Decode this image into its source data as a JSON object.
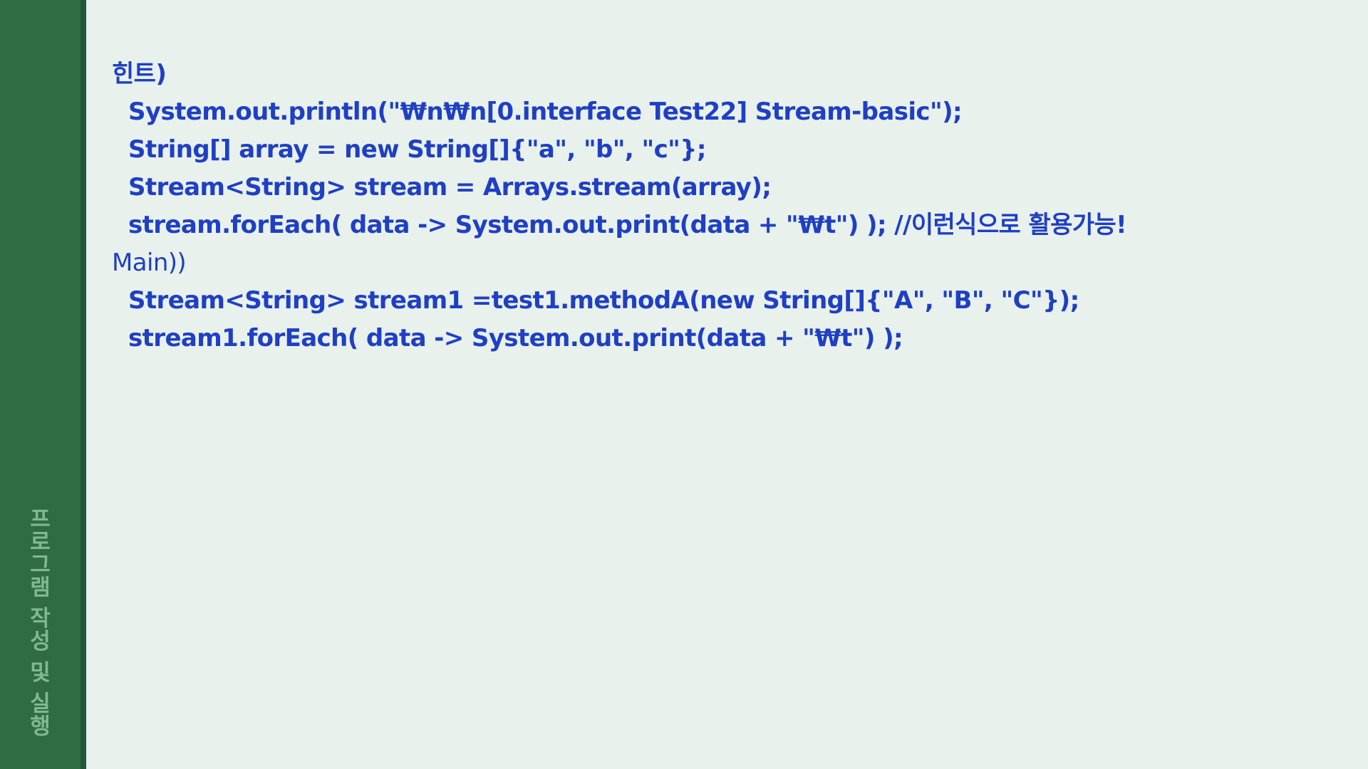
{
  "sidebar": {
    "title": "프로그램 작성 및 실행"
  },
  "content": {
    "hint_heading": "힌트)",
    "hint_lines": [
      "System.out.println(\"₩n₩n[0.interface Test22] Stream-basic\");",
      "String[] array = new String[]{\"a\", \"b\", \"c\"};",
      "Stream<String> stream = Arrays.stream(array);",
      "stream.forEach( data -> System.out.print(data + \"₩t\") ); //이런식으로 활용가능!"
    ],
    "main_heading": "Main))",
    "main_lines": [
      "Stream<String> stream1 =test1.methodA(new String[]{\"A\", \"B\", \"C\"});",
      "stream1.forEach( data -> System.out.print(data + \"₩t\") );"
    ]
  },
  "colors": {
    "background": "#e8f1ec",
    "sidebar": "#2f6b43",
    "sidebar_edge": "#23573a",
    "sidebar_text": "#7fb893",
    "code_text": "#1f3fc4"
  }
}
